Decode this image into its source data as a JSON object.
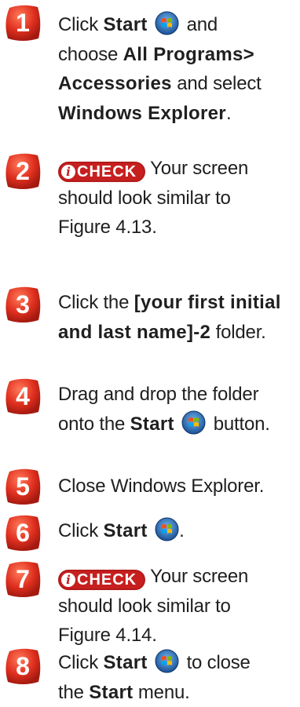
{
  "steps": [
    {
      "number": "1"
    },
    {
      "number": "2"
    },
    {
      "number": "3"
    },
    {
      "number": "4"
    },
    {
      "number": "5"
    },
    {
      "number": "6"
    },
    {
      "number": "7"
    },
    {
      "number": "8"
    }
  ],
  "text": {
    "click": "Click",
    "click_the": "Click the",
    "start": "Start",
    "and": "and",
    "choose": "choose",
    "all_programs": "All Programs>",
    "accessories": "Accessories",
    "and_select": "and select",
    "windows_explorer": "Windows Explorer",
    "period": ".",
    "check": "CHECK",
    "your_screen": "Your screen",
    "should_look": "should look similar to",
    "figure_413": "Figure 4.13.",
    "figure_414": "Figure 4.14.",
    "folder_name_1": "[your first initial",
    "folder_name_2": "and last name]-2",
    "folder": "folder.",
    "drag_drop": "Drag and drop the folder",
    "onto_the": "onto the",
    "button": "button.",
    "close_explorer": "Close Windows Explorer.",
    "to_close": "to close",
    "the": "the",
    "menu": "menu."
  },
  "colors": {
    "badge_red": "#d42a1e",
    "check_red": "#c71f1f"
  },
  "icons": {
    "start_orb": "windows-start-orb-icon",
    "check_info": "info-icon"
  }
}
